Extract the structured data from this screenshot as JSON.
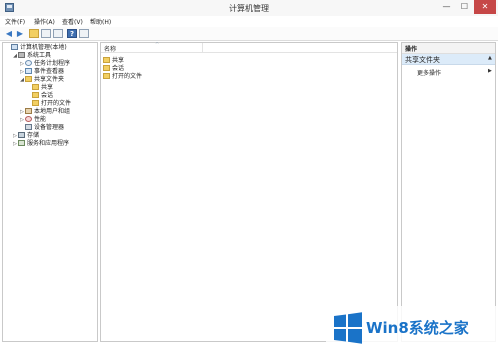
{
  "window": {
    "title": "计算机管理",
    "min_label": "—",
    "max_label": "☐",
    "close_label": "✕"
  },
  "menu": [
    "文件(F)",
    "操作(A)",
    "查看(V)",
    "帮助(H)"
  ],
  "toolbar": {
    "back_glyph": "◀",
    "forward_glyph": "▶",
    "help_glyph": "?"
  },
  "tree": [
    {
      "label": "计算机管理(本地)",
      "icon": "computer-icon",
      "twisty": "",
      "indent": 0
    },
    {
      "label": "系统工具",
      "icon": "tools-icon",
      "twisty": "◢",
      "indent": 1
    },
    {
      "label": "任务计划程序",
      "icon": "clock-icon",
      "twisty": "▷",
      "indent": 2
    },
    {
      "label": "事件查看器",
      "icon": "event-log-icon",
      "twisty": "▷",
      "indent": 2
    },
    {
      "label": "共享文件夹",
      "icon": "folder-icon",
      "twisty": "◢",
      "indent": 2
    },
    {
      "label": "共享",
      "icon": "folder-icon",
      "twisty": "",
      "indent": 3
    },
    {
      "label": "会话",
      "icon": "folder-icon",
      "twisty": "",
      "indent": 3
    },
    {
      "label": "打开的文件",
      "icon": "folder-icon",
      "twisty": "",
      "indent": 3
    },
    {
      "label": "本地用户和组",
      "icon": "users-icon",
      "twisty": "▷",
      "indent": 2
    },
    {
      "label": "性能",
      "icon": "performance-icon",
      "twisty": "▷",
      "indent": 2
    },
    {
      "label": "设备管理器",
      "icon": "device-manager-icon",
      "twisty": "",
      "indent": 2
    },
    {
      "label": "存储",
      "icon": "storage-icon",
      "twisty": "▷",
      "indent": 1
    },
    {
      "label": "服务和应用程序",
      "icon": "services-icon",
      "twisty": "▷",
      "indent": 1
    }
  ],
  "list": {
    "column_name": "名称",
    "sort_glyph": "^",
    "items": [
      "共享",
      "会话",
      "打开的文件"
    ]
  },
  "actions": {
    "title": "操作",
    "section": "共享文件夹",
    "collapse_glyph": "▲",
    "more": "更多操作",
    "more_arrow": "▶"
  },
  "watermark": {
    "text": "Win8系统之家"
  },
  "colors": {
    "accent": "#1a73c8",
    "selection": "#dcebf9",
    "close": "#c64747",
    "folder": "#f2cf62"
  }
}
